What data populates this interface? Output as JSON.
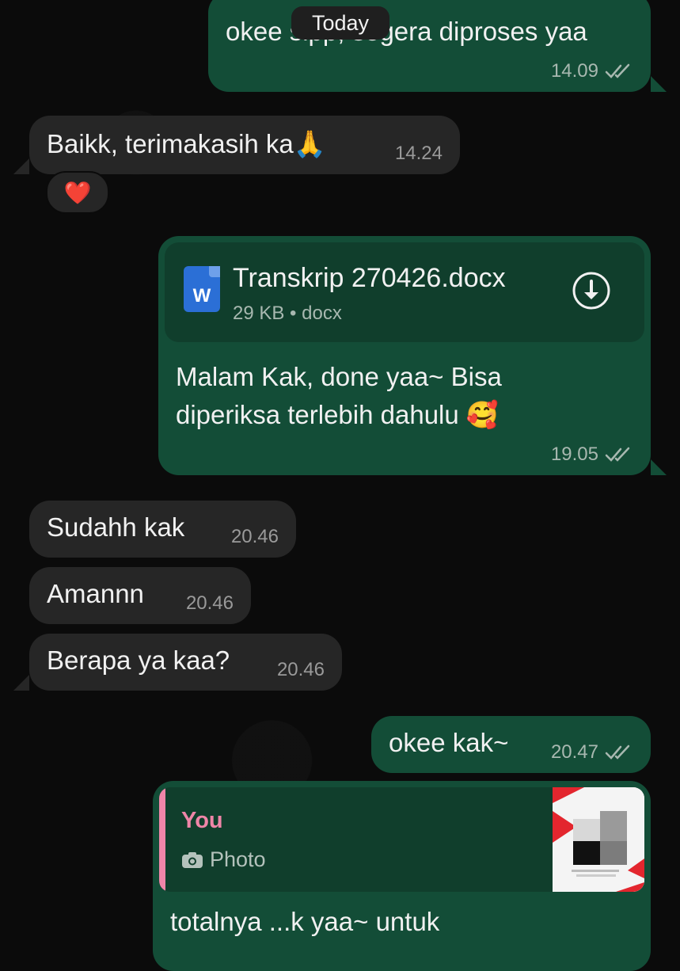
{
  "chat": {
    "date_divider": "Today",
    "messages": [
      {
        "direction": "out",
        "text": "okee sipp, segera diproses yaa",
        "time": "14.09",
        "status": "read"
      },
      {
        "direction": "in",
        "text": "Baikk, terimakasih ka🙏",
        "time": "14.24",
        "reaction": "❤️"
      },
      {
        "direction": "out",
        "attachment": {
          "name": "Transkrip 270426.docx",
          "meta": "29 KB • docx",
          "icon": "word-doc-icon",
          "icon_letter": "W"
        },
        "line1": "Malam Kak, done yaa~ Bisa",
        "line2": "diperiksa terlebih dahulu 🥰",
        "time": "19.05",
        "status": "read"
      },
      {
        "direction": "in",
        "text": "Sudahh kak",
        "time": "20.46"
      },
      {
        "direction": "in",
        "text": "Amannn",
        "time": "20.46"
      },
      {
        "direction": "in",
        "text": "Berapa ya kaa?",
        "time": "20.46"
      },
      {
        "direction": "out",
        "text": "okee kak~",
        "time": "20.47",
        "status": "read"
      },
      {
        "direction": "out",
        "reply_to": {
          "author": "You",
          "type": "Photo",
          "icon": "camera-icon"
        },
        "text": "totalnya ...k yaa~ untuk"
      }
    ]
  },
  "colors": {
    "outgoing_bubble": "#134d37",
    "incoming_bubble": "#262626",
    "reply_accent": "#ef85a8"
  }
}
